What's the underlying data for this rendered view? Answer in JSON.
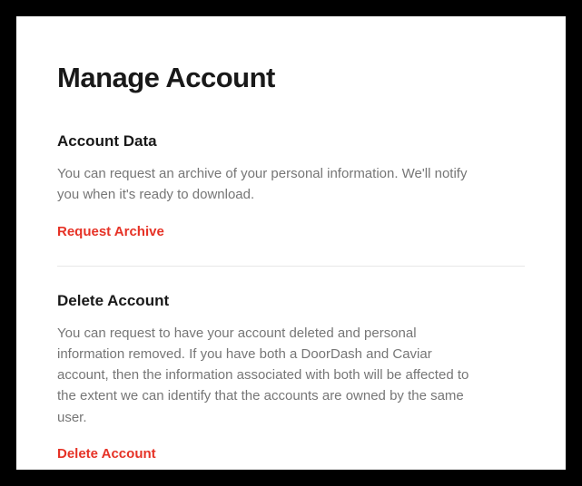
{
  "page": {
    "title": "Manage Account"
  },
  "sections": {
    "accountData": {
      "title": "Account Data",
      "description": "You can request an archive of your personal information. We'll notify you when it's ready to download.",
      "actionLabel": "Request Archive"
    },
    "deleteAccount": {
      "title": "Delete Account",
      "description": "You can request to have your account deleted and personal information removed. If you have both a DoorDash and Caviar account, then the information associated with both will be affected to the extent we can identify that the accounts are owned by the same user.",
      "actionLabel": "Delete Account"
    }
  }
}
